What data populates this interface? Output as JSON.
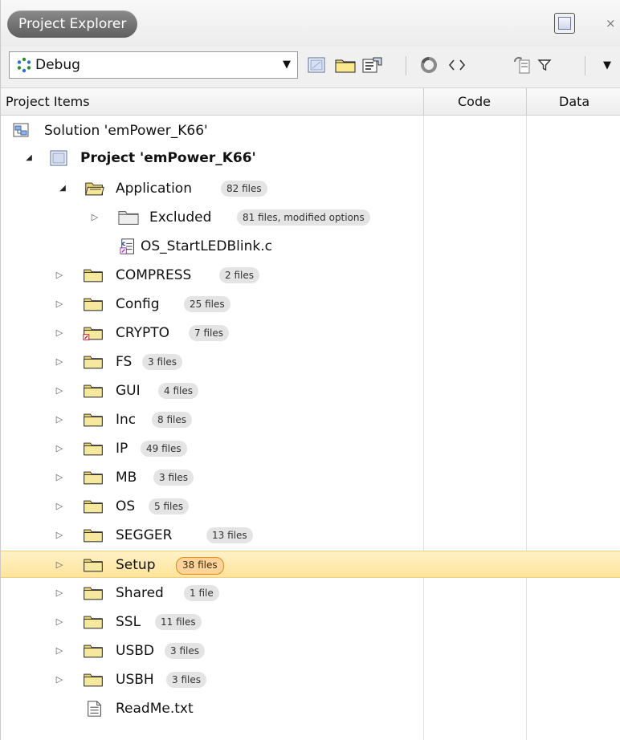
{
  "window": {
    "title": "Project Explorer",
    "close_glyph": "×"
  },
  "toolbar": {
    "configuration": "Debug",
    "dropdown_glyph": "▼",
    "overflow_glyph": "▼",
    "icons": [
      "properties-icon",
      "new-folder-icon",
      "options-icon",
      "refresh-icon",
      "code-icon",
      "link-icon",
      "filter-icon"
    ]
  },
  "columns": {
    "project_items": "Project Items",
    "code": "Code",
    "data": "Data"
  },
  "tree": {
    "solution": {
      "label": "Solution 'emPower_K66'"
    },
    "project": {
      "label": "Project 'emPower_K66'"
    },
    "application": {
      "label": "Application",
      "badge": "82 files"
    },
    "excluded": {
      "label": "Excluded",
      "badge": "81 files, modified options"
    },
    "os_start": {
      "label": "OS_StartLEDBlink.c"
    },
    "folders": [
      {
        "label": "COMPRESS",
        "badge": "2 files"
      },
      {
        "label": "Config",
        "badge": "25 files"
      },
      {
        "label": "CRYPTO",
        "badge": "7 files"
      },
      {
        "label": "FS",
        "badge": "3 files"
      },
      {
        "label": "GUI",
        "badge": "4 files"
      },
      {
        "label": "Inc",
        "badge": "8 files"
      },
      {
        "label": "IP",
        "badge": "49 files"
      },
      {
        "label": "MB",
        "badge": "3 files"
      },
      {
        "label": "OS",
        "badge": "5 files"
      },
      {
        "label": "SEGGER",
        "badge": "13 files"
      },
      {
        "label": "Setup",
        "badge": "38 files"
      },
      {
        "label": "Shared",
        "badge": "1 file"
      },
      {
        "label": "SSL",
        "badge": "11 files"
      },
      {
        "label": "USBD",
        "badge": "3 files"
      },
      {
        "label": "USBH",
        "badge": "3 files"
      }
    ],
    "readme": {
      "label": "ReadMe.txt"
    }
  },
  "colors": {
    "selected_row": "#ffe7a6",
    "selected_badge_border": "#e08a1a",
    "folder": "#f3e48a",
    "badge_bg": "#e4e4e4"
  }
}
